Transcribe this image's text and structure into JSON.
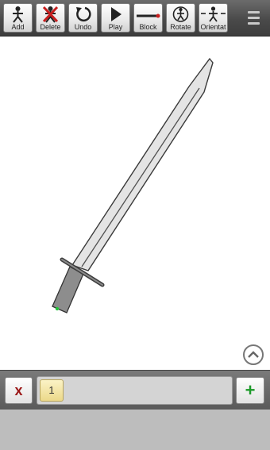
{
  "toolbar": {
    "tools": [
      {
        "label": "Add",
        "icon": "stickfigure-add-icon"
      },
      {
        "label": "Delete",
        "icon": "stickfigure-delete-icon"
      },
      {
        "label": "Undo",
        "icon": "undo-arrow-icon"
      },
      {
        "label": "Play",
        "icon": "play-triangle-icon"
      },
      {
        "label": "Block",
        "icon": "block-line-icon"
      },
      {
        "label": "Rotate",
        "icon": "rotate-figure-icon"
      },
      {
        "label": "Orientat",
        "icon": "orientation-figure-icon"
      }
    ],
    "menu_icon": "hamburger-menu-icon"
  },
  "canvas": {
    "object": "sword",
    "collapse_icon": "chevron-up-circle-icon"
  },
  "framebar": {
    "delete_label": "x",
    "frames": [
      {
        "label": "1"
      }
    ],
    "add_label": "+"
  },
  "colors": {
    "toolbar_bg": "#4a4a4a",
    "frame_thumb": "#f3e6a6",
    "delete_red": "#9b1818",
    "add_green": "#1d9a2a",
    "joint_green": "#22c43a"
  }
}
